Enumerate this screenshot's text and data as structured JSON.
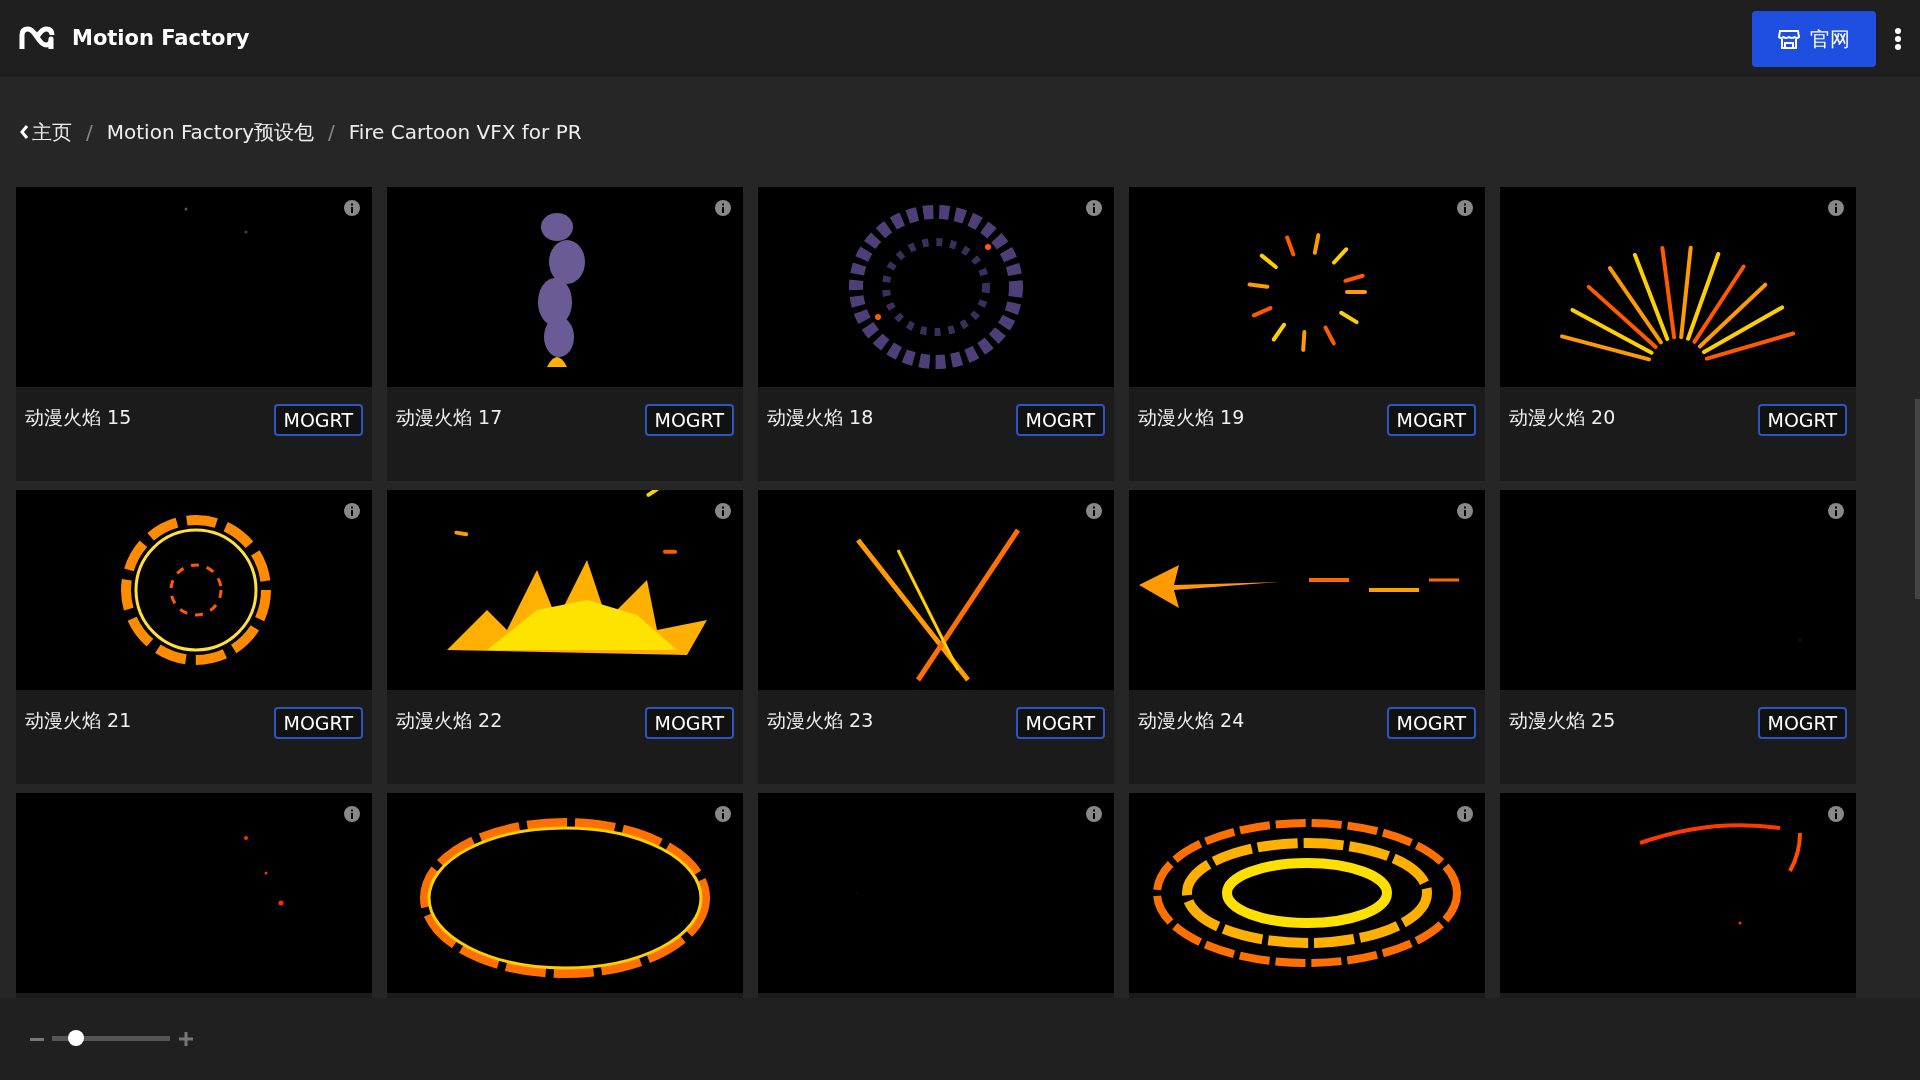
{
  "header": {
    "brand": "Motion Factory",
    "site_button": "官网"
  },
  "breadcrumb": [
    "主页",
    "Motion Factory预设包",
    "Fire Cartoon VFX for PR"
  ],
  "breadcrumb_separators": [
    "/",
    "/"
  ],
  "cards": [
    {
      "kind": "picture",
      "title": "动漫火焰 15",
      "button": "MOGRT"
    },
    {
      "kind": "picture",
      "title": "动漫火焰 17",
      "button": "MOGRT"
    },
    {
      "kind": "picture",
      "title": "动漫火焰 18",
      "button": "MOGRT"
    },
    {
      "kind": "picture",
      "title": "动漫火焰 19",
      "button": "MOGRT"
    },
    {
      "kind": "picture",
      "title": "动漫火焰 20",
      "button": "MOGRT"
    },
    {
      "kind": "picture",
      "title": "动漫火焰 21",
      "button": "MOGRT"
    },
    {
      "kind": "picture",
      "title": "动漫火焰 22",
      "button": "MOGRT"
    },
    {
      "kind": "picture",
      "title": "动漫火焰 23",
      "button": "MOGRT"
    },
    {
      "kind": "picture",
      "title": "动漫火焰 24",
      "button": "MOGRT"
    },
    {
      "kind": "picture",
      "title": "动漫火焰 25",
      "button": "MOGRT"
    },
    {
      "kind": "picture"
    },
    {
      "kind": "picture"
    },
    {
      "kind": "picture"
    },
    {
      "kind": "picture"
    },
    {
      "kind": "picture"
    }
  ],
  "zoom_slider": {
    "level": 0.2
  }
}
